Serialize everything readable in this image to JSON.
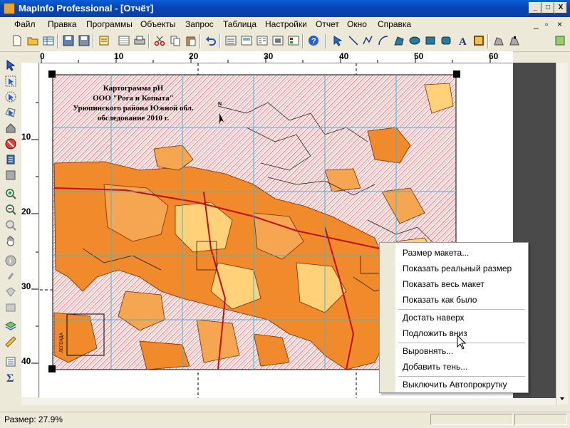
{
  "window": {
    "title": "MapInfo Professional - [Отчёт]",
    "minimize": "_",
    "maximize": "□",
    "close": "X"
  },
  "menu": {
    "items": [
      "Файл",
      "Правка",
      "Программы",
      "Объекты",
      "Запрос",
      "Таблица",
      "Настройки",
      "Отчет",
      "Окно",
      "Справка"
    ],
    "mdi_min": "_",
    "mdi_restore": "▫",
    "mdi_close": "×"
  },
  "toolbar": {
    "icons": [
      "new-icon",
      "open-icon",
      "save-icon",
      "save-as-icon",
      "open-table-icon",
      "layer-control-icon",
      "print-icon",
      "cut-icon",
      "copy-icon",
      "paste-icon",
      "undo-icon",
      "browser-icon",
      "graph-icon",
      "layout-icon",
      "redistrict-icon",
      "help-icon",
      "hotlink-icon",
      "line-icon",
      "polyline-icon",
      "arc-icon",
      "polygon-icon",
      "ellipse-icon",
      "rectangle-icon",
      "text-icon",
      "frame-icon",
      "reshape-icon",
      "add-node-icon",
      "toolbar-misc-icon"
    ]
  },
  "left_tools": {
    "icons": [
      "select-icon",
      "marquee-select-icon",
      "radius-select-icon",
      "boundary-select-icon",
      "graph-select-icon",
      "invert-select-icon",
      "grabber-icon",
      "layer-icon",
      "zoom-in-icon",
      "zoom-out-icon",
      "change-view-icon",
      "pan-icon",
      "info-icon",
      "label-icon",
      "drag-window-icon",
      "ruler-icon",
      "legend-icon",
      "statistics-icon"
    ]
  },
  "ruler": {
    "h_labels": [
      "0",
      "10",
      "20",
      "30",
      "40",
      "50",
      "60"
    ],
    "v_labels": [
      "10",
      "20",
      "30",
      "40"
    ]
  },
  "map": {
    "title_lines": [
      "Картограмма pH",
      "ООО \"Рога и Копыта\"",
      "Урюпинского района Южной обл.",
      "обследование 2010 г."
    ],
    "north_label": "N",
    "legend_label": "ЛЕГЕНДА"
  },
  "context_menu": {
    "items": [
      "Размер макета...",
      "Показать реальный размер",
      "Показать весь макет",
      "Показать как было",
      "Достать наверх",
      "Подложить вниз",
      "Выровнять...",
      "Добавить тень...",
      "Выключить Автопрокрутку"
    ]
  },
  "status": {
    "text": "Размер: 27.9%"
  },
  "colors": {
    "title_bar": "#0846b8",
    "hatch_red": "#d84040",
    "field_orange": "#f08a2a",
    "field_light": "#ffd27a",
    "grid_cyan": "#3ab8d8"
  }
}
